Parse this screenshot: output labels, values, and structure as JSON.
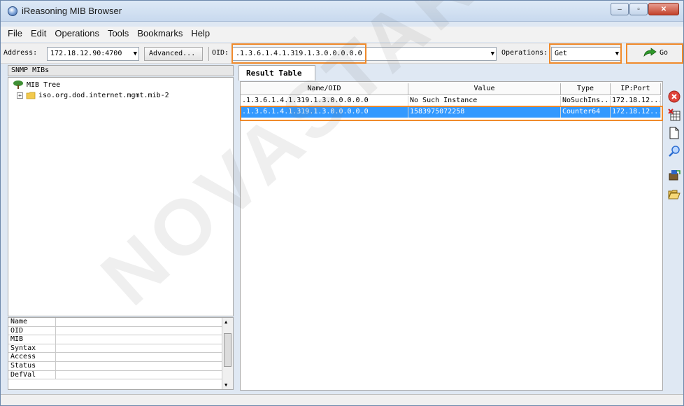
{
  "window": {
    "title": "iReasoning MIB Browser",
    "controls": {
      "minimize": "–",
      "maximize": "▫",
      "close": "✕"
    }
  },
  "menu": [
    "File",
    "Edit",
    "Operations",
    "Tools",
    "Bookmarks",
    "Help"
  ],
  "toolbar": {
    "address_label": "Address:",
    "address_value": "172.18.12.90:4700",
    "advanced_label": "Advanced...",
    "oid_label": "OID:",
    "oid_value": ".1.3.6.1.4.1.319.1.3.0.0.0.0.0",
    "operations_label": "Operations:",
    "operations_value": "Get",
    "go_label": "Go"
  },
  "left": {
    "header": "SNMP MIBs",
    "tree_root": "MIB Tree",
    "tree_child": "iso.org.dod.internet.mgmt.mib-2",
    "properties": [
      "Name",
      "OID",
      "MIB",
      "Syntax",
      "Access",
      "Status",
      "DefVal"
    ]
  },
  "result": {
    "tab_label": "Result Table",
    "columns": [
      "Name/OID",
      "Value",
      "Type",
      "IP:Port"
    ],
    "rows": [
      {
        "oid": ".1.3.6.1.4.1.319.1.3.0.0.0.0.0",
        "value": "No Such Instance",
        "type": "NoSuchIns...",
        "ipport": "172.18.12..."
      },
      {
        "oid": ".1.3.6.1.4.1.319.1.3.0.0.0.0.0",
        "value": "1583975072258",
        "type": "Counter64",
        "ipport": "172.18.12..."
      }
    ]
  },
  "side_tools": [
    "stop-icon",
    "delete-table-icon",
    "new-document-icon",
    "search-icon",
    "export-icon",
    "open-folder-icon"
  ],
  "watermark": "NOVASTAR TECH",
  "colors": {
    "highlight": "#f08a2b",
    "selection": "#3399ff",
    "go_arrow": "#2e9a2a"
  }
}
